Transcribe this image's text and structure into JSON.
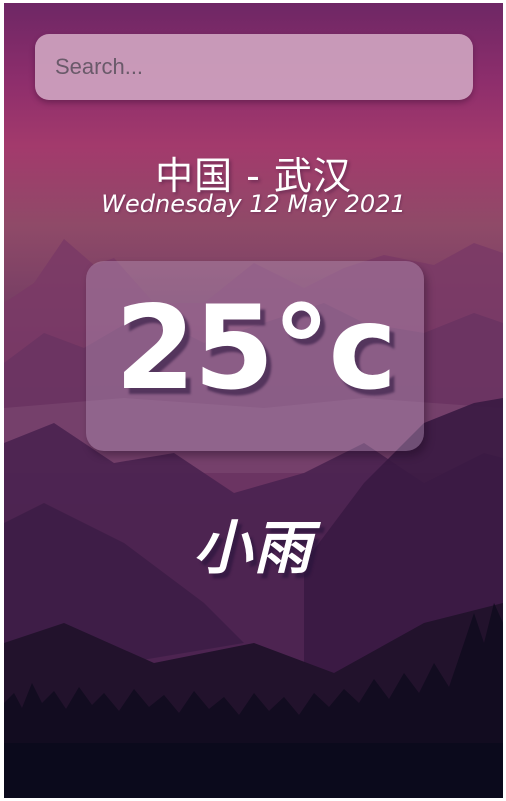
{
  "search": {
    "placeholder": "Search...",
    "value": ""
  },
  "location": {
    "text": "中国 - 武汉"
  },
  "date": {
    "text": "Wednesday 12 May 2021"
  },
  "temperature": {
    "text": "25°c"
  },
  "weather": {
    "text": "小雨"
  },
  "colors": {
    "sky_top": "#6e2765",
    "sky_mid": "#a33a6c",
    "ground": "#0b0a1c",
    "text": "#ffffff"
  },
  "icons": {
    "background": "mountain-landscape-illustration"
  }
}
